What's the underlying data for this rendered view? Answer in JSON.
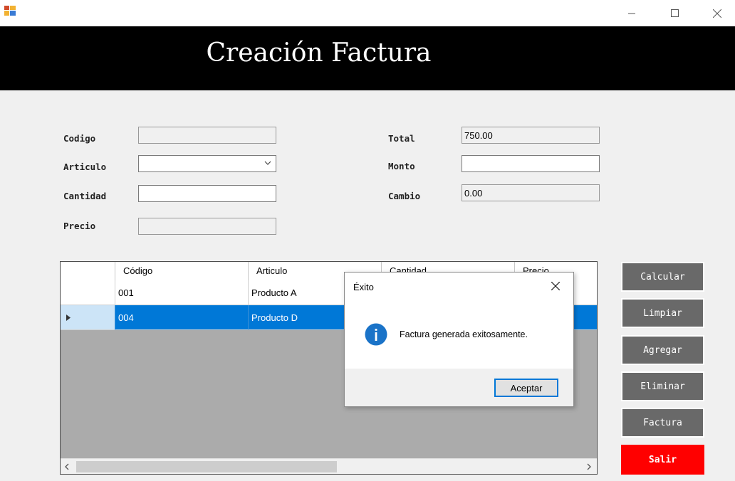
{
  "window": {
    "icon": "winforms-app-icon",
    "controls": [
      "minimize-icon",
      "maximize-icon",
      "close-icon"
    ]
  },
  "header": {
    "title": "Creación Factura"
  },
  "form": {
    "codigo_label": "Codigo",
    "codigo_value": "",
    "articulo_label": "Articulo",
    "articulo_value": "",
    "cantidad_label": "Cantidad",
    "cantidad_value": "",
    "precio_label": "Precio",
    "precio_value": "",
    "total_label": "Total",
    "total_value": "750.00",
    "monto_label": "Monto",
    "monto_value": "",
    "cambio_label": "Cambio",
    "cambio_value": "0.00"
  },
  "grid": {
    "columns": [
      "Código",
      "Articulo",
      "Cantidad",
      "Precio"
    ],
    "rows": [
      {
        "codigo": "001",
        "articulo": "Producto A",
        "cantidad": "",
        "precio": ""
      },
      {
        "codigo": "004",
        "articulo": "Producto D",
        "cantidad": "",
        "precio": ""
      }
    ],
    "selected_row": 1
  },
  "buttons": {
    "calcular": "Calcular",
    "limpiar": "Limpiar",
    "agregar": "Agregar",
    "eliminar": "Eliminar",
    "factura": "Factura",
    "salir": "Salir"
  },
  "colors": {
    "header_bg": "#000000",
    "button_bg": "#696969",
    "salir_bg": "#ff0000",
    "selection": "#0078d7"
  },
  "dialog": {
    "title": "Éxito",
    "icon": "info-icon",
    "message": "Factura generada exitosamente.",
    "ok_label": "Aceptar"
  }
}
